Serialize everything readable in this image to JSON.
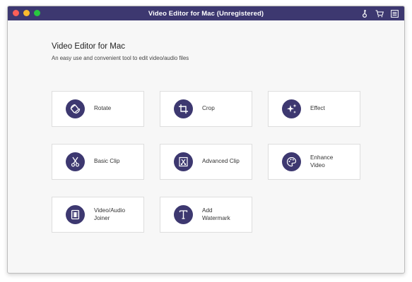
{
  "window": {
    "title": "Video Editor for Mac (Unregistered)"
  },
  "toolbar_icons": [
    "key-icon",
    "cart-icon",
    "menu-icon"
  ],
  "main": {
    "heading": "Video Editor for Mac",
    "subheading": "An easy use and convenient tool to edit video/audio files"
  },
  "tools": [
    {
      "label": "Rotate",
      "icon": "rotate-icon"
    },
    {
      "label": "Crop",
      "icon": "crop-icon"
    },
    {
      "label": "Effect",
      "icon": "effect-icon"
    },
    {
      "label": "Basic Clip",
      "icon": "scissors-icon"
    },
    {
      "label": "Advanced Clip",
      "icon": "advanced-clip-icon"
    },
    {
      "label": "Enhance\nVideo",
      "icon": "palette-icon"
    },
    {
      "label": "Video/Audio\nJoiner",
      "icon": "film-joiner-icon"
    },
    {
      "label": "Add\nWatermark",
      "icon": "text-watermark-icon"
    }
  ],
  "colors": {
    "accent": "#3d3870",
    "card_border": "#dedede",
    "background": "#f7f7f7"
  }
}
